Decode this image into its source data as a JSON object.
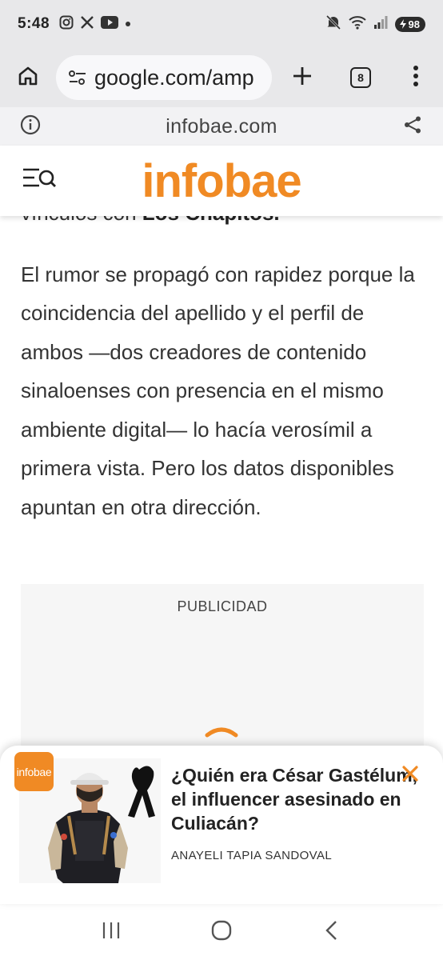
{
  "status_bar": {
    "time": "5:48",
    "battery": "98",
    "left_icons": [
      "instagram-icon",
      "x-icon",
      "youtube-icon",
      "dot-icon"
    ],
    "right_icons": [
      "mute-icon",
      "wifi-icon",
      "signal-icon",
      "battery-icon"
    ]
  },
  "browser": {
    "url": "google.com/amp",
    "tab_count": "8",
    "site_domain": "infobae.com"
  },
  "site": {
    "logo": "infobae"
  },
  "article": {
    "p1_text": "vínculos con ",
    "p1_bold": "Los Chapitos.",
    "p2": "El rumor se propagó con rapidez porque la coincidencia del apellido y el perfil de ambos —dos creadores de contenido sinaloenses con presencia en el mismo ambiente digital— lo hacía verosímil a primera vista. Pero los datos disponibles apuntan en otra dirección."
  },
  "ad": {
    "label": "PUBLICIDAD"
  },
  "recommendation": {
    "badge": "infobae",
    "title": "¿Quién era César Gastélum, el influencer asesinado en Culiacán?",
    "author": "ANAYELI TAPIA SANDOVAL"
  },
  "colors": {
    "brand": "#f08a24",
    "chrome_bg": "#e8e8ea"
  }
}
